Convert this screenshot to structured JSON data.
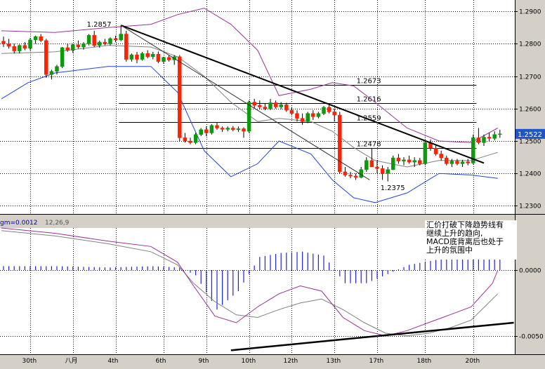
{
  "chart_data": [
    {
      "type": "candlestick",
      "panel": "price",
      "ylim": [
        1.2275,
        1.2935
      ],
      "y_ticks": [
        "1.2900",
        "1.2800",
        "1.2700",
        "1.2600",
        "1.2500",
        "1.2400",
        "1.2300"
      ],
      "x_ticks": [
        "30th",
        "八月",
        "4th",
        "6th",
        "9th",
        "10th",
        "12th",
        "13th",
        "17th",
        "18th",
        "20th"
      ],
      "current_price": "1.2522",
      "levels": [
        {
          "label": "1.2673",
          "value": 1.2673
        },
        {
          "label": "1.2616",
          "value": 1.2616
        },
        {
          "label": "1.2559",
          "value": 1.2559
        },
        {
          "label": "1.2478",
          "value": 1.2478
        }
      ],
      "annotations": [
        {
          "label": "1.2857",
          "value": 1.2857
        },
        {
          "label": "1.2375",
          "value": 1.2375
        }
      ],
      "trendline": {
        "from": {
          "x": 0,
          "y": 1.2857
        },
        "to": {
          "x": 90,
          "y": 1.2432
        }
      },
      "candles": [
        [
          1.2808,
          1.2822,
          1.279,
          1.28
        ],
        [
          1.28,
          1.2815,
          1.2785,
          1.2792
        ],
        [
          1.2792,
          1.28,
          1.277,
          1.2778
        ],
        [
          1.2778,
          1.2798,
          1.277,
          1.2795
        ],
        [
          1.2795,
          1.2805,
          1.278,
          1.2786
        ],
        [
          1.2786,
          1.2818,
          1.278,
          1.2812
        ],
        [
          1.2812,
          1.2825,
          1.28,
          1.2822
        ],
        [
          1.2822,
          1.283,
          1.2805,
          1.281
        ],
        [
          1.281,
          1.2815,
          1.2695,
          1.2705
        ],
        [
          1.2705,
          1.272,
          1.269,
          1.2715
        ],
        [
          1.2715,
          1.2735,
          1.2705,
          1.273
        ],
        [
          1.273,
          1.279,
          1.2725,
          1.2788
        ],
        [
          1.2788,
          1.28,
          1.2775,
          1.278
        ],
        [
          1.278,
          1.28,
          1.2772,
          1.2797
        ],
        [
          1.2797,
          1.281,
          1.2785,
          1.279
        ],
        [
          1.279,
          1.2805,
          1.2782,
          1.28
        ],
        [
          1.28,
          1.283,
          1.2795,
          1.2826
        ],
        [
          1.2826,
          1.284,
          1.279,
          1.2795
        ],
        [
          1.2795,
          1.281,
          1.2788,
          1.2805
        ],
        [
          1.2805,
          1.2815,
          1.2795,
          1.28
        ],
        [
          1.28,
          1.282,
          1.2795,
          1.2816
        ],
        [
          1.2816,
          1.2825,
          1.2805,
          1.2812
        ],
        [
          1.2812,
          1.2857,
          1.2808,
          1.283
        ],
        [
          1.283,
          1.284,
          1.2745,
          1.2752
        ],
        [
          1.2752,
          1.277,
          1.2745,
          1.2766
        ],
        [
          1.2766,
          1.2775,
          1.274,
          1.2752
        ],
        [
          1.2752,
          1.2775,
          1.2748,
          1.277
        ],
        [
          1.277,
          1.278,
          1.2755,
          1.276
        ],
        [
          1.276,
          1.2775,
          1.2752,
          1.2768
        ],
        [
          1.2768,
          1.2776,
          1.274,
          1.2745
        ],
        [
          1.2745,
          1.276,
          1.2738,
          1.2758
        ],
        [
          1.2758,
          1.2765,
          1.2745,
          1.275
        ],
        [
          1.275,
          1.2765,
          1.2735,
          1.276
        ],
        [
          1.276,
          1.2765,
          1.25,
          1.251
        ],
        [
          1.251,
          1.2525,
          1.2495,
          1.25
        ],
        [
          1.25,
          1.251,
          1.249,
          1.2495
        ],
        [
          1.2495,
          1.2525,
          1.249,
          1.252
        ],
        [
          1.252,
          1.254,
          1.2515,
          1.2535
        ],
        [
          1.2535,
          1.2545,
          1.2515,
          1.2525
        ],
        [
          1.2525,
          1.2552,
          1.252,
          1.2548
        ],
        [
          1.2548,
          1.2558,
          1.2535,
          1.254
        ],
        [
          1.254,
          1.2545,
          1.2528,
          1.2536
        ],
        [
          1.2536,
          1.2545,
          1.253,
          1.254
        ],
        [
          1.254,
          1.2546,
          1.253,
          1.2535
        ],
        [
          1.2535,
          1.2545,
          1.2528,
          1.2538
        ],
        [
          1.2538,
          1.2542,
          1.251,
          1.253
        ],
        [
          1.253,
          1.2625,
          1.2525,
          1.262
        ],
        [
          1.262,
          1.263,
          1.26,
          1.261
        ],
        [
          1.261,
          1.2625,
          1.2598,
          1.2605
        ],
        [
          1.2605,
          1.2616,
          1.2595,
          1.26
        ],
        [
          1.26,
          1.263,
          1.2595,
          1.2618
        ],
        [
          1.2618,
          1.2625,
          1.26,
          1.2605
        ],
        [
          1.2605,
          1.262,
          1.2598,
          1.2612
        ],
        [
          1.2612,
          1.2618,
          1.259,
          1.2595
        ],
        [
          1.2595,
          1.2605,
          1.258,
          1.2585
        ],
        [
          1.2585,
          1.2595,
          1.256,
          1.257
        ],
        [
          1.257,
          1.2585,
          1.255,
          1.256
        ],
        [
          1.256,
          1.259,
          1.2555,
          1.2585
        ],
        [
          1.2585,
          1.2595,
          1.2565,
          1.2575
        ],
        [
          1.2575,
          1.259,
          1.257,
          1.2585
        ],
        [
          1.2585,
          1.2608,
          1.258,
          1.2604
        ],
        [
          1.2604,
          1.2615,
          1.2585,
          1.259
        ],
        [
          1.259,
          1.26,
          1.256,
          1.258
        ],
        [
          1.258,
          1.259,
          1.24,
          1.2405
        ],
        [
          1.2405,
          1.242,
          1.239,
          1.2395
        ],
        [
          1.2395,
          1.2405,
          1.2385,
          1.2392
        ],
        [
          1.2392,
          1.24,
          1.238,
          1.2388
        ],
        [
          1.2388,
          1.242,
          1.2385,
          1.2412
        ],
        [
          1.2412,
          1.245,
          1.2405,
          1.244
        ],
        [
          1.244,
          1.2478,
          1.243,
          1.242
        ],
        [
          1.242,
          1.244,
          1.24,
          1.2415
        ],
        [
          1.2415,
          1.2425,
          1.238,
          1.24
        ],
        [
          1.24,
          1.242,
          1.2375,
          1.2412
        ],
        [
          1.2412,
          1.2455,
          1.241,
          1.2448
        ],
        [
          1.2448,
          1.246,
          1.243,
          1.2438
        ],
        [
          1.2438,
          1.245,
          1.2425,
          1.2442
        ],
        [
          1.2442,
          1.2455,
          1.243,
          1.2435
        ],
        [
          1.2435,
          1.245,
          1.242,
          1.244
        ],
        [
          1.244,
          1.2448,
          1.2425,
          1.243
        ],
        [
          1.243,
          1.25,
          1.2425,
          1.2495
        ],
        [
          1.2495,
          1.2505,
          1.247,
          1.2478
        ],
        [
          1.2478,
          1.249,
          1.2455,
          1.246
        ],
        [
          1.246,
          1.247,
          1.244,
          1.2448
        ],
        [
          1.2448,
          1.2455,
          1.2425,
          1.243
        ],
        [
          1.243,
          1.2445,
          1.242,
          1.2438
        ],
        [
          1.2438,
          1.2445,
          1.2425,
          1.243
        ],
        [
          1.243,
          1.2442,
          1.242,
          1.2436
        ],
        [
          1.2436,
          1.2445,
          1.2425,
          1.2432
        ],
        [
          1.2432,
          1.252,
          1.2428,
          1.251
        ],
        [
          1.251,
          1.254,
          1.249,
          1.2495
        ],
        [
          1.2495,
          1.252,
          1.2485,
          1.2512
        ],
        [
          1.2512,
          1.2525,
          1.25,
          1.2508
        ],
        [
          1.2508,
          1.253,
          1.2502,
          1.252
        ],
        [
          1.252,
          1.2535,
          1.251,
          1.2522
        ]
      ],
      "bollinger": {
        "upper": [
          [
            0,
            1.284
          ],
          [
            10,
            1.2835
          ],
          [
            20,
            1.285
          ],
          [
            28,
            1.286
          ],
          [
            33,
            1.289
          ],
          [
            38,
            1.291
          ],
          [
            43,
            1.286
          ],
          [
            48,
            1.278
          ],
          [
            52,
            1.264
          ],
          [
            58,
            1.266
          ],
          [
            62,
            1.268
          ],
          [
            66,
            1.267
          ],
          [
            70,
            1.262
          ],
          [
            76,
            1.254
          ],
          [
            82,
            1.25
          ],
          [
            88,
            1.2495
          ],
          [
            93,
            1.254
          ]
        ],
        "lower": [
          [
            0,
            1.263
          ],
          [
            5,
            1.268
          ],
          [
            10,
            1.271
          ],
          [
            20,
            1.273
          ],
          [
            28,
            1.273
          ],
          [
            33,
            1.265
          ],
          [
            38,
            1.247
          ],
          [
            43,
            1.239
          ],
          [
            48,
            1.243
          ],
          [
            52,
            1.25
          ],
          [
            58,
            1.246
          ],
          [
            62,
            1.238
          ],
          [
            66,
            1.2325
          ],
          [
            70,
            1.231
          ],
          [
            76,
            1.234
          ],
          [
            82,
            1.24
          ],
          [
            88,
            1.2395
          ],
          [
            93,
            1.2385
          ]
        ],
        "middle": [
          [
            0,
            1.277
          ],
          [
            10,
            1.2775
          ],
          [
            20,
            1.2795
          ],
          [
            28,
            1.279
          ],
          [
            33,
            1.276
          ],
          [
            38,
            1.27
          ],
          [
            43,
            1.262
          ],
          [
            48,
            1.256
          ],
          [
            52,
            1.257
          ],
          [
            58,
            1.256
          ],
          [
            62,
            1.253
          ],
          [
            66,
            1.248
          ],
          [
            70,
            1.244
          ],
          [
            76,
            1.242
          ],
          [
            82,
            1.244
          ],
          [
            88,
            1.244
          ],
          [
            93,
            1.2465
          ]
        ]
      }
    },
    {
      "type": "macd",
      "panel": "indicator",
      "header": "gm=0.0012",
      "params": "12,26,9",
      "y_ticks": [
        "0.0000",
        "-0.0050"
      ],
      "ylim": [
        -0.0064,
        0.0032
      ],
      "macd_line": [
        [
          0,
          0.0032
        ],
        [
          10,
          0.0028
        ],
        [
          20,
          0.0022
        ],
        [
          28,
          0.0018
        ],
        [
          33,
          0.0006
        ],
        [
          36,
          -0.0012
        ],
        [
          40,
          -0.0035
        ],
        [
          44,
          -0.004
        ],
        [
          48,
          -0.0028
        ],
        [
          52,
          -0.0018
        ],
        [
          56,
          -0.0012
        ],
        [
          60,
          -0.0016
        ],
        [
          64,
          -0.0036
        ],
        [
          68,
          -0.0046
        ],
        [
          72,
          -0.005
        ],
        [
          76,
          -0.0046
        ],
        [
          80,
          -0.004
        ],
        [
          84,
          -0.0034
        ],
        [
          88,
          -0.0028
        ],
        [
          92,
          -0.001
        ],
        [
          93,
          0.0
        ]
      ],
      "signal_line": [
        [
          0,
          0.003
        ],
        [
          10,
          0.0026
        ],
        [
          20,
          0.002
        ],
        [
          28,
          0.0014
        ],
        [
          33,
          0.0004
        ],
        [
          36,
          -0.001
        ],
        [
          40,
          -0.0024
        ],
        [
          44,
          -0.0034
        ],
        [
          48,
          -0.0036
        ],
        [
          52,
          -0.003
        ],
        [
          56,
          -0.0025
        ],
        [
          60,
          -0.0022
        ],
        [
          64,
          -0.003
        ],
        [
          68,
          -0.004
        ],
        [
          72,
          -0.0048
        ],
        [
          76,
          -0.005
        ],
        [
          80,
          -0.0048
        ],
        [
          84,
          -0.0044
        ],
        [
          88,
          -0.0038
        ],
        [
          92,
          -0.0022
        ],
        [
          93,
          -0.0018
        ]
      ],
      "histogram": [
        [
          0,
          0.0003
        ],
        [
          10,
          0.0003
        ],
        [
          20,
          0.0002
        ],
        [
          28,
          0.0003
        ],
        [
          33,
          0.0002
        ],
        [
          36,
          -0.0004
        ],
        [
          40,
          -0.003
        ],
        [
          44,
          -0.0016
        ],
        [
          48,
          0.001
        ],
        [
          52,
          0.0013
        ],
        [
          56,
          0.0014
        ],
        [
          60,
          0.0011
        ],
        [
          64,
          -0.001
        ],
        [
          68,
          -0.001
        ],
        [
          72,
          -0.0003
        ],
        [
          76,
          0.0004
        ],
        [
          80,
          0.0007
        ],
        [
          84,
          0.001
        ],
        [
          88,
          0.0011
        ],
        [
          92,
          0.0013
        ],
        [
          93,
          0.0012
        ]
      ],
      "trendline": {
        "from": {
          "x": 46,
          "y": -0.0061
        },
        "to": {
          "x": 102,
          "y": -0.004
        }
      }
    }
  ],
  "annotation_text": "汇价打破下降趋势线有\n继续上升的趋向,\nMACD底背离后也处于\n上升的氛围中",
  "colors": {
    "background": "#d4d0c8",
    "panel_bg": "#ffffff",
    "grid": "#000000",
    "bull": "#0a9a0a",
    "bear": "#ff2200",
    "boll_upper": "#993399",
    "boll_lower": "#2244dd",
    "boll_middle": "#808080",
    "macd": "#993399",
    "signal": "#808080",
    "hist": "#2222dd",
    "trend": "#000000"
  }
}
